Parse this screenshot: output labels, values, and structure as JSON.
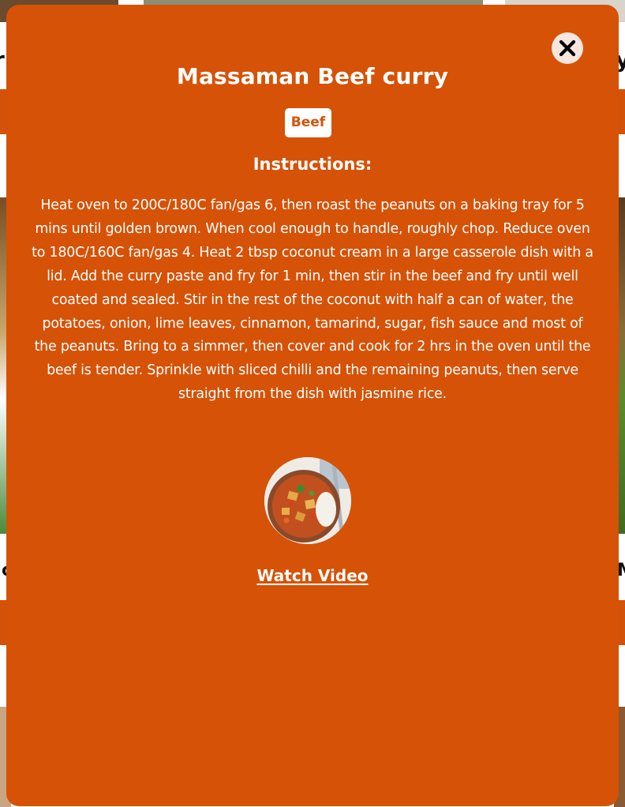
{
  "modal": {
    "title": "Massaman Beef curry",
    "category": "Beef",
    "instructions_heading": "Instructions:",
    "instructions": "Heat oven to 200C/180C fan/gas 6, then roast the peanuts on a baking tray for 5 mins until golden brown. When cool enough to handle, roughly chop. Reduce oven to 180C/160C fan/gas 4. Heat 2 tbsp coconut cream in a large casserole dish with a lid. Add the curry paste and fry for 1 min, then stir in the beef and fry until well coated and sealed. Stir in the rest of the coconut with half a can of water, the potatoes, onion, lime leaves, cinnamon, tamarind, sugar, fish sauce and most of the peanuts. Bring to a simmer, then cover and cook for 2 hrs in the oven until the beef is tender. Sprinkle with sliced chilli and the remaining peanuts, then serve straight from the dish with jasmine rice.",
    "video_link": "Watch Video",
    "close_icon": "close-icon",
    "thumbnail_icon": "recipe-thumbnail"
  },
  "colors": {
    "modal_bg": "#d55207",
    "text": "#ffffff",
    "badge_bg": "#ffffff",
    "badge_text": "#d55207",
    "close_bg": "#f7e6de"
  }
}
